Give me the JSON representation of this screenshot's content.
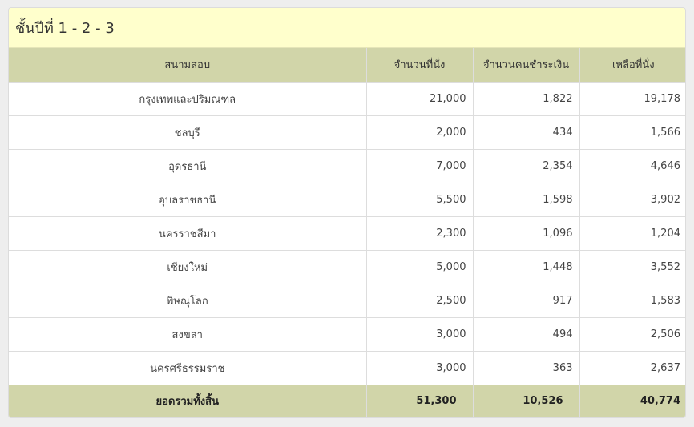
{
  "panel": {
    "title": "ชั้นปีที่ 1 - 2 - 3"
  },
  "table": {
    "headers": [
      "สนามสอบ",
      "จำนวนที่นั่ง",
      "จำนวนคนชำระเงิน",
      "เหลือที่นั่ง"
    ],
    "rows": [
      {
        "venue": "กรุงเทพและปริมณฑล",
        "seats": "21,000",
        "paid": "1,822",
        "remaining": "19,178"
      },
      {
        "venue": "ชลบุรี",
        "seats": "2,000",
        "paid": "434",
        "remaining": "1,566"
      },
      {
        "venue": "อุดรธานี",
        "seats": "7,000",
        "paid": "2,354",
        "remaining": "4,646"
      },
      {
        "venue": "อุบลราชธานี",
        "seats": "5,500",
        "paid": "1,598",
        "remaining": "3,902"
      },
      {
        "venue": "นครราชสีมา",
        "seats": "2,300",
        "paid": "1,096",
        "remaining": "1,204"
      },
      {
        "venue": "เชียงใหม่",
        "seats": "5,000",
        "paid": "1,448",
        "remaining": "3,552"
      },
      {
        "venue": "พิษณุโลก",
        "seats": "2,500",
        "paid": "917",
        "remaining": "1,583"
      },
      {
        "venue": "สงขลา",
        "seats": "3,000",
        "paid": "494",
        "remaining": "2,506"
      },
      {
        "venue": "นครศรีธรรมราช",
        "seats": "3,000",
        "paid": "363",
        "remaining": "2,637"
      }
    ],
    "total": {
      "label": "ยอดรวมทั้งสิ้น",
      "seats": "51,300",
      "paid": "10,526",
      "remaining": "40,774"
    }
  },
  "colors": {
    "heading_bg": "#ffffcc",
    "table_header_bg": "#d1d5a9",
    "page_bg": "#eeeeee"
  }
}
